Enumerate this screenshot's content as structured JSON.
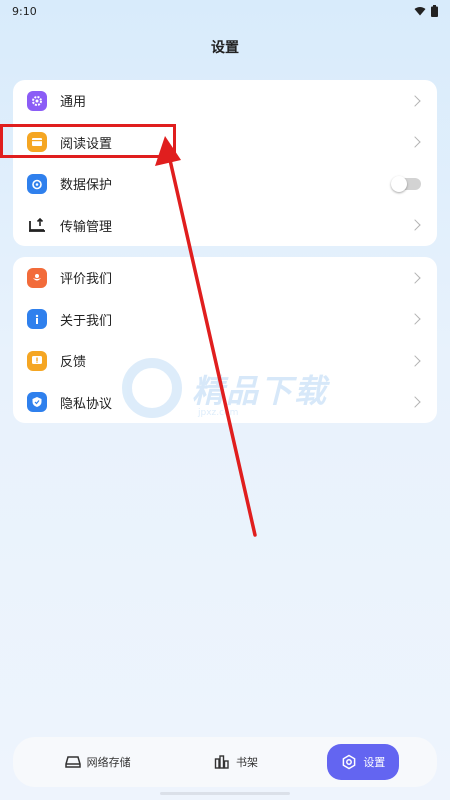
{
  "status_bar": {
    "time": "9:10"
  },
  "page_title": "设置",
  "group1": [
    {
      "label": "通用",
      "icon": "gear-icon",
      "color": "#8b5cf6",
      "control": "chevron"
    },
    {
      "label": "阅读设置",
      "icon": "book-icon",
      "color": "#f5a623",
      "control": "chevron"
    },
    {
      "label": "数据保护",
      "icon": "shield-lock-icon",
      "color": "#2f80ed",
      "control": "toggle"
    },
    {
      "label": "传输管理",
      "icon": "transfer-icon",
      "color": "#222222",
      "control": "chevron"
    }
  ],
  "group2": [
    {
      "label": "评价我们",
      "icon": "flower-icon",
      "color": "#f26b3a",
      "control": "chevron"
    },
    {
      "label": "关于我们",
      "icon": "info-icon",
      "color": "#2f80ed",
      "control": "chevron"
    },
    {
      "label": "反馈",
      "icon": "feedback-icon",
      "color": "#f5a623",
      "control": "chevron"
    },
    {
      "label": "隐私协议",
      "icon": "privacy-shield-icon",
      "color": "#2f80ed",
      "control": "chevron"
    }
  ],
  "data_protection_enabled": false,
  "watermark": {
    "text": "精品下载",
    "sub": "jpxz.com"
  },
  "bottom_nav": [
    {
      "label": "网络存储",
      "icon": "network-storage-icon",
      "active": false
    },
    {
      "label": "书架",
      "icon": "bookshelf-icon",
      "active": false
    },
    {
      "label": "设置",
      "icon": "settings-icon",
      "active": true
    }
  ],
  "colors": {
    "accent": "#6365f1",
    "annotation": "#e01e1e"
  }
}
